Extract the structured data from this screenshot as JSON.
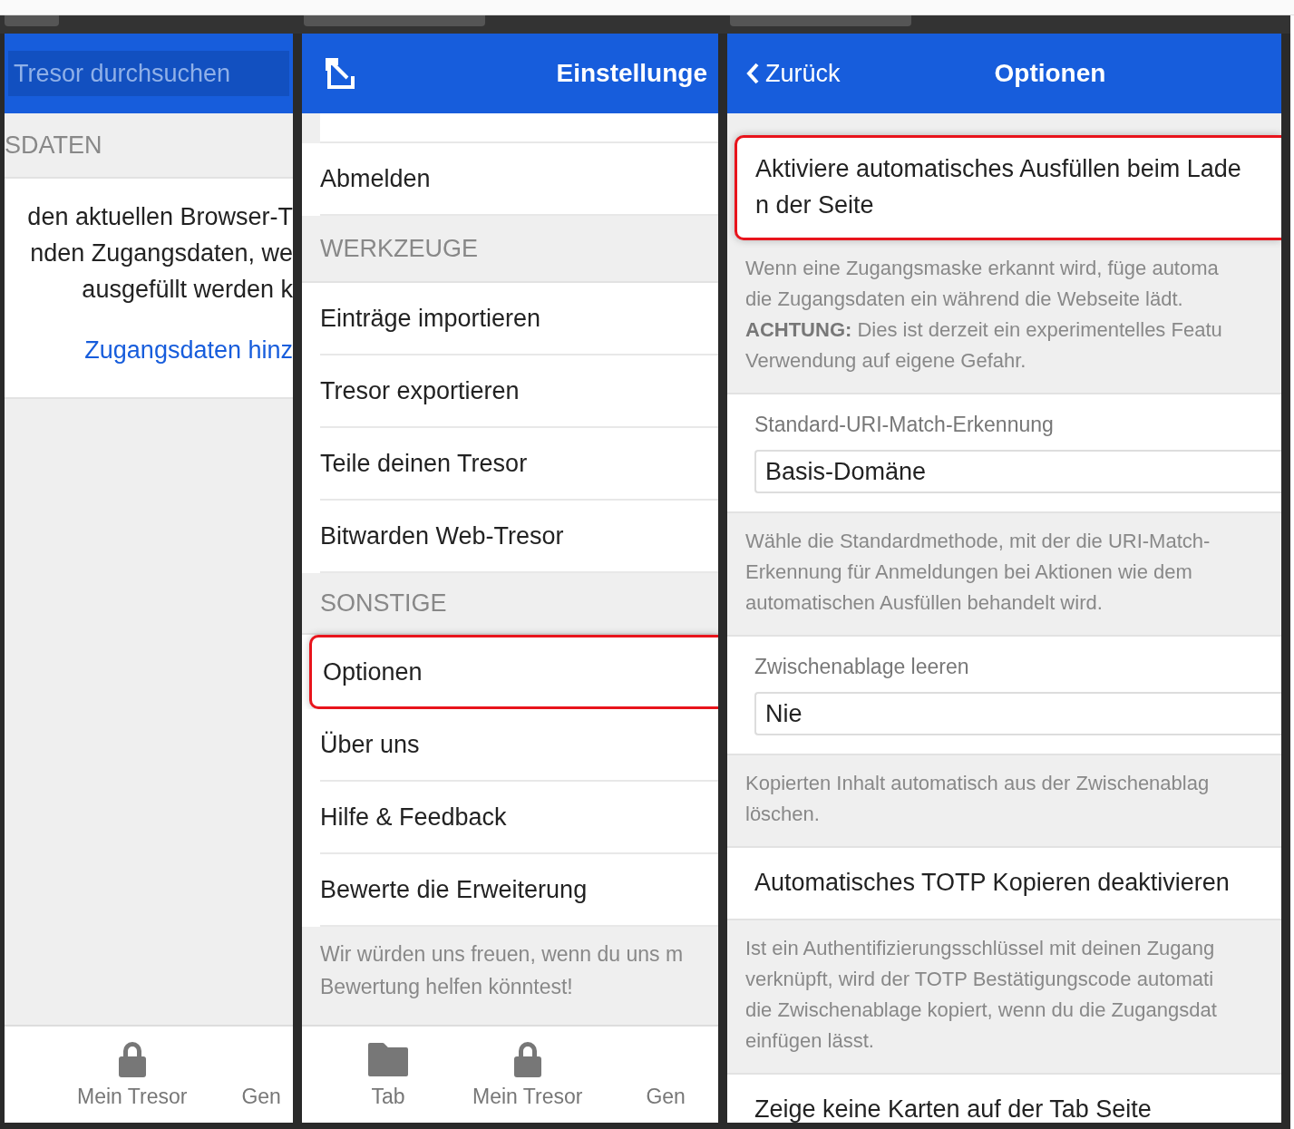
{
  "vault": {
    "search": {
      "placeholder": "Tresor durchsuchen"
    },
    "section_header": "SDATEN",
    "message_lines": [
      "den aktuellen Browser-T",
      "nden Zugangsdaten, we",
      "ausgefüllt werden k"
    ],
    "link": "Zugangsdaten hinz",
    "nav": [
      {
        "label": "Mein Tresor",
        "kind": "lock"
      },
      {
        "label": "Gen",
        "kind": "none"
      }
    ]
  },
  "settings": {
    "title": "Einstellunge",
    "groups": [
      {
        "items": [
          {
            "label": "Abmelden",
            "highlighted": false
          }
        ]
      },
      {
        "header": "WERKZEUGE",
        "items": [
          {
            "label": "Einträge importieren",
            "highlighted": false
          },
          {
            "label": "Tresor exportieren",
            "highlighted": false
          },
          {
            "label": "Teile deinen Tresor",
            "highlighted": false
          },
          {
            "label": "Bitwarden Web-Tresor",
            "highlighted": false
          }
        ]
      },
      {
        "header": "SONSTIGE",
        "items": [
          {
            "label": "Optionen",
            "highlighted": true
          },
          {
            "label": "Über uns",
            "highlighted": false
          },
          {
            "label": "Hilfe & Feedback",
            "highlighted": false
          },
          {
            "label": "Bewerte die Erweiterung",
            "highlighted": false
          }
        ]
      }
    ],
    "footer_lines": [
      "Wir würden uns freuen, wenn du uns m",
      "Bewertung helfen könntest!"
    ],
    "nav": [
      {
        "label": "Tab",
        "kind": "folder"
      },
      {
        "label": "Mein Tresor",
        "kind": "lock"
      },
      {
        "label": "Gen",
        "kind": "none"
      }
    ]
  },
  "options": {
    "back": "Zurück",
    "title": "Optionen",
    "sections": [
      {
        "kind": "toggle",
        "label_lines": [
          "Aktiviere automatisches Ausfüllen beim Lade",
          "n der Seite"
        ],
        "highlighted": true,
        "description_lines": [
          "Wenn eine Zugangsmaske erkannt wird, füge automa",
          "die Zugangsdaten ein während die Webseite lädt.",
          "**ACHTUNG:** Dies ist derzeit ein experimentelles Featu",
          "Verwendung auf eigene Gefahr."
        ]
      },
      {
        "kind": "select",
        "label_lines": [
          "Standard-URI-Match-Erkennung"
        ],
        "value": "Basis-Domäne",
        "highlighted": false,
        "description_lines": [
          "Wähle die Standardmethode, mit der die URI-Match-",
          "Erkennung für Anmeldungen bei Aktionen wie dem",
          "automatischen Ausfüllen behandelt wird."
        ]
      },
      {
        "kind": "select",
        "label_lines": [
          "Zwischenablage leeren"
        ],
        "value": "Nie",
        "highlighted": false,
        "description_lines": [
          "Kopierten Inhalt automatisch aus der Zwischenablag",
          "löschen."
        ]
      },
      {
        "kind": "toggle",
        "label_lines": [
          "Automatisches TOTP Kopieren deaktivieren"
        ],
        "highlighted": false,
        "description_lines": [
          "Ist ein Authentifizierungsschlüssel mit deinen Zugang",
          "verknüpft, wird der TOTP Bestätigungscode automati",
          "die Zwischenablage kopiert, wenn du die Zugangsdat",
          "einfügen lässt."
        ]
      },
      {
        "kind": "toggle",
        "label_lines": [
          "Zeige keine Karten auf der Tab Seite"
        ],
        "highlighted": false
      }
    ]
  }
}
